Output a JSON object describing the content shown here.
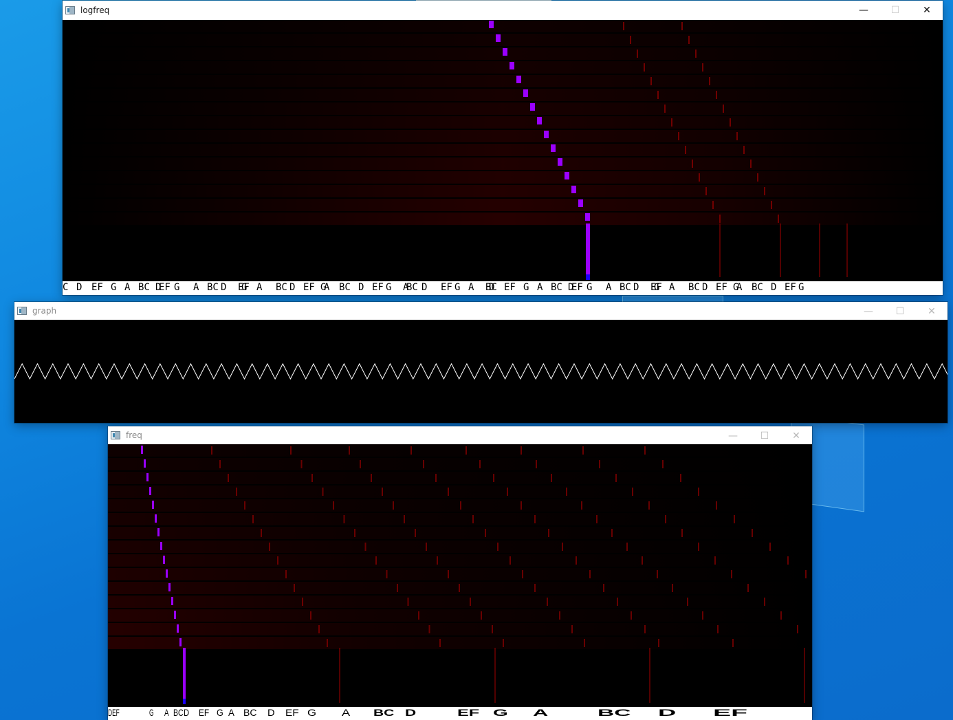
{
  "windows": {
    "logfreq": {
      "title": "logfreq",
      "note_labels": [
        "C",
        "D",
        "EF",
        "G",
        "A",
        "BC",
        "D",
        "EF",
        "G",
        "A",
        "BC",
        "D",
        "EF",
        "G",
        "A",
        "BC",
        "D",
        "EF",
        "G",
        "A",
        "BC",
        "D",
        "EF",
        "G",
        "A",
        "BC",
        "D",
        "EF",
        "G",
        "A",
        "BC",
        "D",
        "EF",
        "G",
        "A",
        "BC",
        "D",
        "EF",
        "G",
        "A",
        "BC",
        "D",
        "EF",
        "G",
        "A",
        "BC",
        "D",
        "EF",
        "G",
        "A",
        "BC",
        "D",
        "EF",
        "G"
      ]
    },
    "graph": {
      "title": "graph"
    },
    "freq": {
      "title": "freq",
      "note_labels": [
        "DEF",
        "G",
        "A",
        "BC",
        "D",
        "EF",
        "G",
        "A",
        "BC",
        "D",
        "EF",
        "G",
        "A",
        "BC",
        "D",
        "EF",
        "G",
        "A",
        "BC",
        "D",
        "EF"
      ]
    }
  },
  "caption_controls": {
    "minimize": "—",
    "maximize": "☐",
    "close": "✕"
  },
  "colors": {
    "peak": "#9b00ff",
    "peak_base": "#1a00ff",
    "harmonic": "#8a0000",
    "background_glow": "#2a0000",
    "waveform": "#ffffff"
  },
  "icons": {
    "app_icon": "window-app-icon"
  }
}
